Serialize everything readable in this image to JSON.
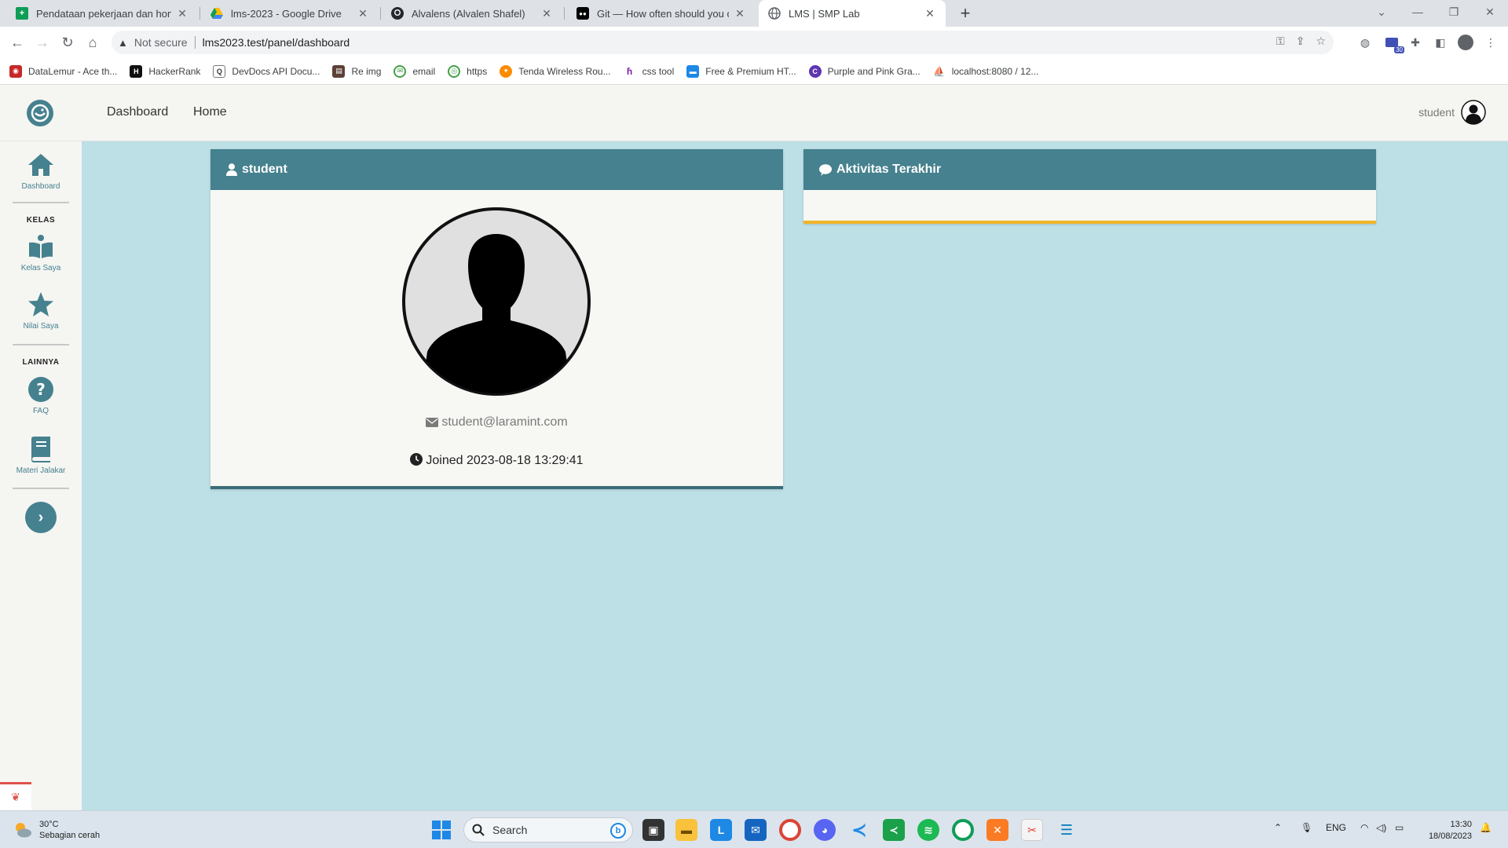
{
  "browser": {
    "tabs": [
      {
        "title": "Pendataan pekerjaan dan honor",
        "icon": "sheets-icon"
      },
      {
        "title": "lms-2023 - Google Drive",
        "icon": "drive-icon"
      },
      {
        "title": "Alvalens (Alvalen Shafel)",
        "icon": "github-icon"
      },
      {
        "title": "Git — How often should you cor",
        "icon": "medium-icon"
      },
      {
        "title": "LMS | SMP Lab",
        "icon": "globe-icon",
        "active": true
      }
    ],
    "address": {
      "security": "Not secure",
      "url": "lms2023.test/panel/dashboard"
    },
    "bookmarks": [
      "DataLemur - Ace th...",
      "HackerRank",
      "DevDocs API Docu...",
      "Re img",
      "email",
      "https",
      "Tenda Wireless Rou...",
      "css tool",
      "Free & Premium HT...",
      "Purple and Pink Gra...",
      "localhost:8080 / 12..."
    ],
    "extension_badge": "30"
  },
  "app": {
    "nav": {
      "dashboard": "Dashboard",
      "home": "Home",
      "user": "student"
    },
    "sidebar": {
      "dashboard": "Dashboard",
      "section_kelas": "KELAS",
      "kelas_saya": "Kelas Saya",
      "nilai_saya": "Nilai Saya",
      "section_lainnya": "LAINNYA",
      "faq": "FAQ",
      "materi": "Materi Jalakar"
    },
    "profile_card": {
      "title": "student",
      "email": "student@laramint.com",
      "joined": "Joined 2023-08-18 13:29:41"
    },
    "activity_card": {
      "title": "Aktivitas Terakhir"
    },
    "colors": {
      "primary": "#45818e",
      "page_bg": "#bddfe6",
      "card_bg": "#f7f7f4",
      "activity_accent": "#f0b429"
    }
  },
  "taskbar": {
    "weather_temp": "30°C",
    "weather_desc": "Sebagian cerah",
    "search_label": "Search",
    "lang": "ENG",
    "time": "13:30",
    "date": "18/08/2023"
  }
}
